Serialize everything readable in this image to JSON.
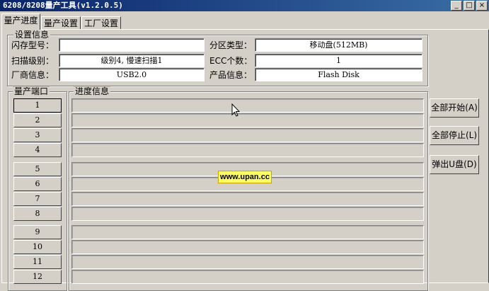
{
  "window": {
    "title": "6208/8208量产工具(v1.2.0.5)",
    "min": "_",
    "max": "□",
    "close": "×"
  },
  "tabs": [
    "量产进度",
    "量产设置",
    "工厂设置"
  ],
  "settings": {
    "group_title": "设置信息",
    "flash_model_label": "闪存型号：",
    "flash_model_value": "",
    "scan_level_label": "扫描级别：",
    "scan_level_value": "级别4, 慢速扫描1",
    "vendor_label": "厂商信息：",
    "vendor_value": "USB2.0",
    "partition_label": "分区类型：",
    "partition_value": "移动盘(512MB)",
    "ecc_label": "ECC个数：",
    "ecc_value": "1",
    "product_label": "产品信息：",
    "product_value": "Flash Disk"
  },
  "ports": {
    "group_title": "量产端口",
    "items": [
      "1",
      "2",
      "3",
      "4",
      "5",
      "6",
      "7",
      "8",
      "9",
      "10",
      "11",
      "12"
    ]
  },
  "progress": {
    "group_title": "进度信息"
  },
  "actions": {
    "start_all": "全部开始(A)",
    "stop_all": "全部停止(L)",
    "eject_udisk": "弹出U盘(D)"
  },
  "watermark": "www.upan.cc"
}
